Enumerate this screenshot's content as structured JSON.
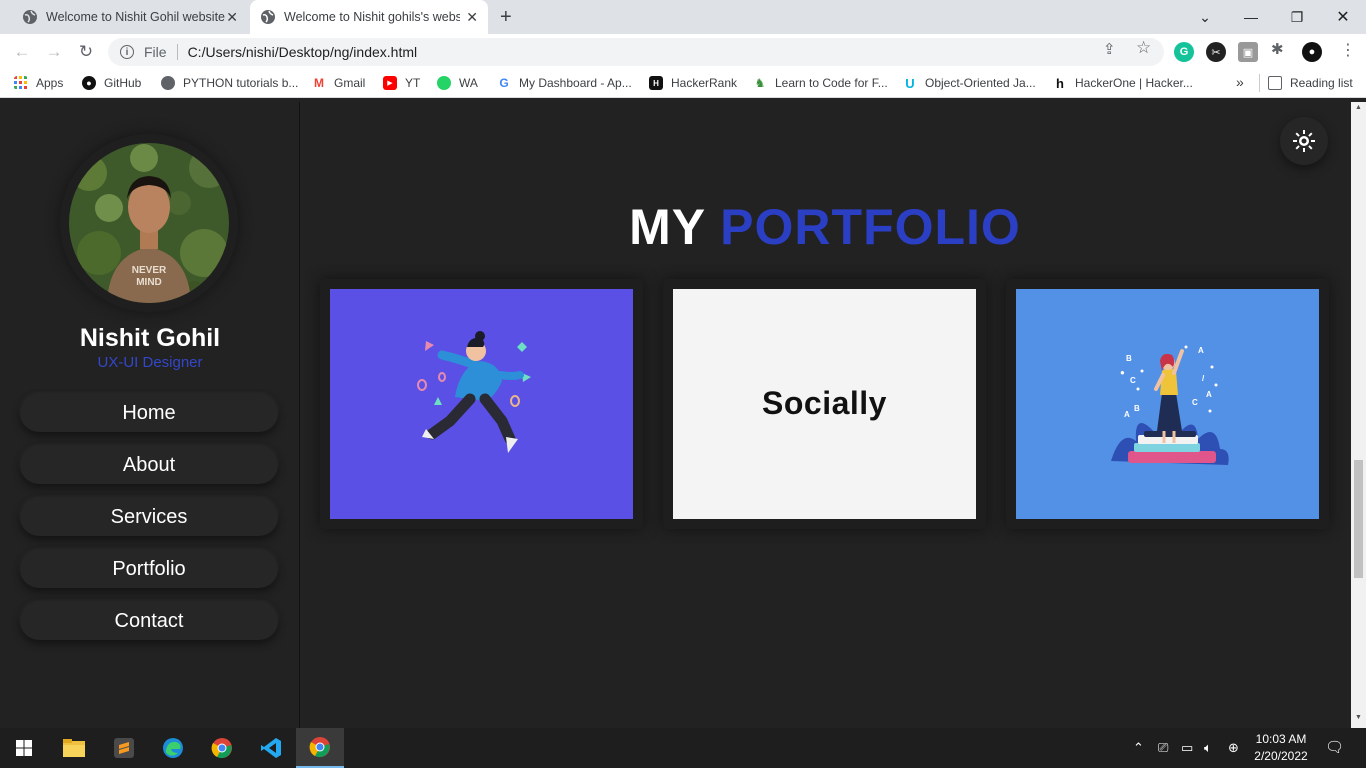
{
  "browser": {
    "tabs": [
      {
        "title": "Welcome to Nishit Gohil website",
        "active": false
      },
      {
        "title": "Welcome to Nishit gohils's website",
        "active": true
      }
    ],
    "new_tab": "+",
    "address": {
      "scheme_label": "File",
      "url": "C:/Users/nishi/Desktop/ng/index.html"
    },
    "bookmarks": [
      {
        "label": "Apps",
        "icon": "apps-grid-icon"
      },
      {
        "label": "GitHub",
        "icon": "github-icon"
      },
      {
        "label": "PYTHON tutorials b...",
        "icon": "globe-icon"
      },
      {
        "label": "Gmail",
        "icon": "gmail-icon"
      },
      {
        "label": "YT",
        "icon": "youtube-icon"
      },
      {
        "label": "WA",
        "icon": "whatsapp-icon"
      },
      {
        "label": "My Dashboard - Ap...",
        "icon": "google-icon"
      },
      {
        "label": "HackerRank",
        "icon": "hackerrank-icon"
      },
      {
        "label": "Learn to Code for F...",
        "icon": "freecodecamp-icon"
      },
      {
        "label": "Object-Oriented Ja...",
        "icon": "udacity-icon"
      },
      {
        "label": "HackerOne | Hacker...",
        "icon": "hackerone-icon"
      }
    ],
    "more_bookmarks": "»",
    "reading_list": "Reading list"
  },
  "sidebar": {
    "name": "Nishit Gohil",
    "role": "UX-UI Designer",
    "nav": [
      "Home",
      "About",
      "Services",
      "Portfolio",
      "Contact"
    ]
  },
  "main": {
    "heading_part1": "MY",
    "heading_part2": "PORTFOLIO",
    "cards": [
      {
        "label": "",
        "bg": "#5b50e6",
        "art": "running-character-illustration"
      },
      {
        "label": "Socially",
        "bg": "#f4f4f4",
        "art": "socially-logo"
      },
      {
        "label": "",
        "bg": "#5291e6",
        "art": "student-on-books-illustration"
      }
    ]
  },
  "taskbar": {
    "time": "10:03 AM",
    "date": "2/20/2022"
  },
  "colors": {
    "accent": "#2b3fc4",
    "role": "#3347c8",
    "bg": "#222222"
  }
}
